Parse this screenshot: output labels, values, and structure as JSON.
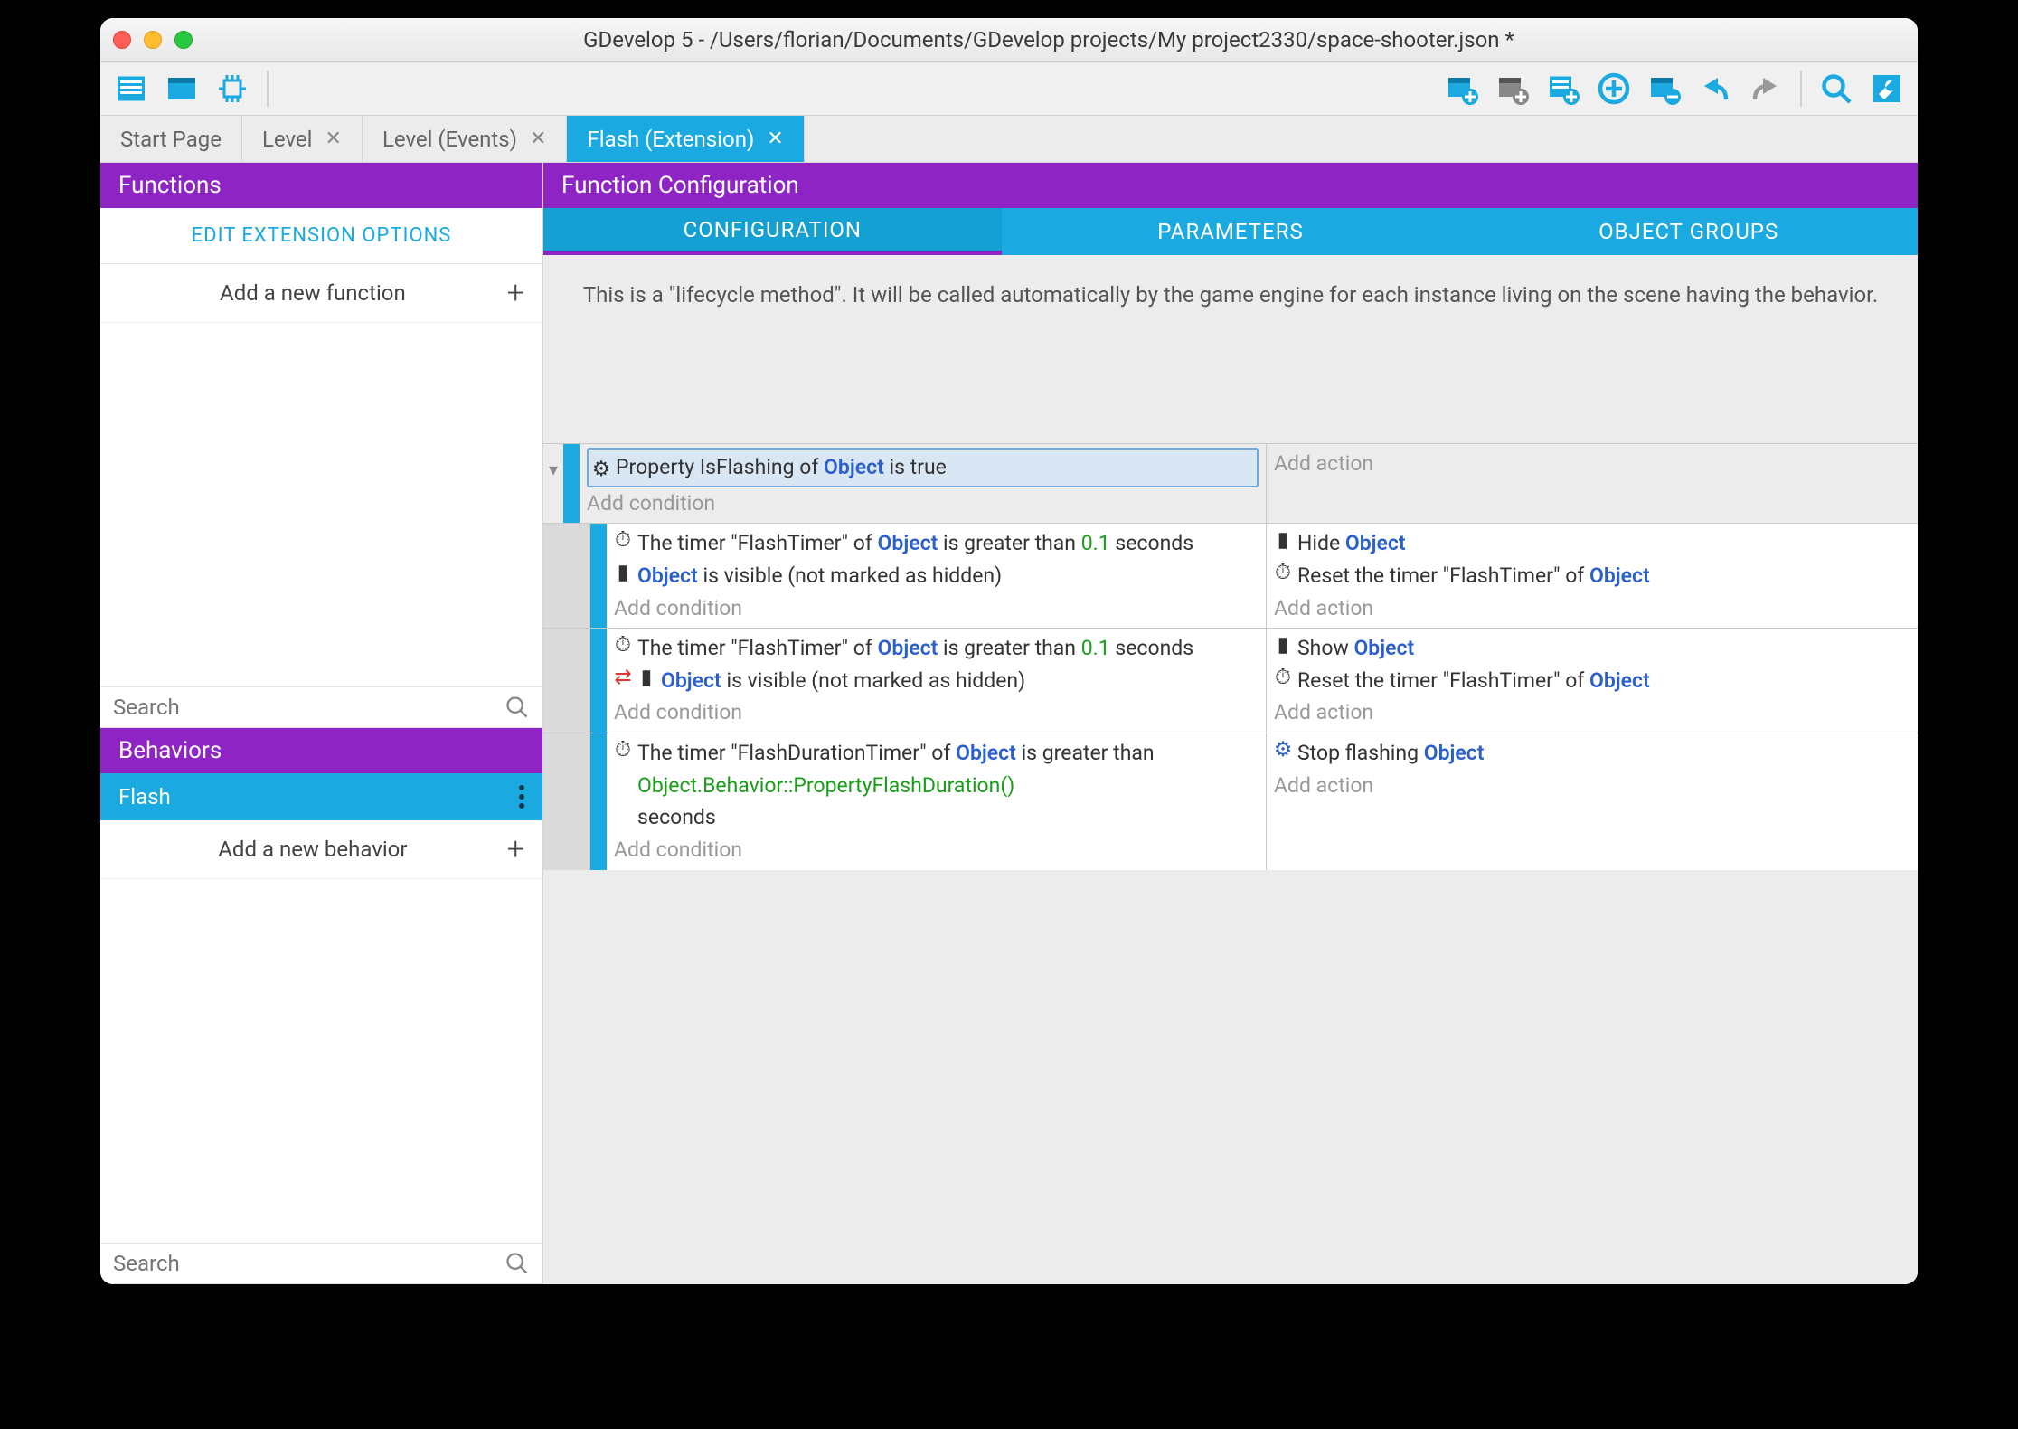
{
  "window": {
    "title": "GDevelop 5 - /Users/florian/Documents/GDevelop projects/My project2330/space-shooter.json *"
  },
  "tabs": [
    {
      "label": "Start Page",
      "closable": false
    },
    {
      "label": "Level",
      "closable": true
    },
    {
      "label": "Level (Events)",
      "closable": true
    },
    {
      "label": "Flash (Extension)",
      "closable": true,
      "active": true
    }
  ],
  "sidebar": {
    "functions_header": "Functions",
    "edit_ext_options": "EDIT EXTENSION OPTIONS",
    "add_function": "Add a new function",
    "search_placeholder": "Search",
    "behaviors_header": "Behaviors",
    "behavior_item": "Flash",
    "add_behavior": "Add a new behavior"
  },
  "config": {
    "header": "Function Configuration",
    "tabs": {
      "configuration": "CONFIGURATION",
      "parameters": "PARAMETERS",
      "object_groups": "OBJECT GROUPS"
    },
    "lifecycle_text": "This is a \"lifecycle method\". It will be called automatically by the game engine for each instance living on the scene having the behavior."
  },
  "events": {
    "add_condition": "Add condition",
    "add_action": "Add action",
    "obj": "Object",
    "root": {
      "cond_prefix": "Property IsFlashing of ",
      "cond_suffix": " is true"
    },
    "e1": {
      "c1a": "The timer \"FlashTimer\" of ",
      "c1b": " is greater than ",
      "c1_num": "0.1",
      "c1c": " seconds",
      "c2b": " is visible (not marked as hidden)",
      "a1": "Hide ",
      "a2a": "Reset the timer \"FlashTimer\" of "
    },
    "e2": {
      "c1a": "The timer \"FlashTimer\" of ",
      "c1b": " is greater than ",
      "c1_num": "0.1",
      "c1c": " seconds",
      "c2b": " is visible (not marked as hidden)",
      "a1": "Show ",
      "a2a": "Reset the timer \"FlashTimer\" of "
    },
    "e3": {
      "c1a": "The timer \"FlashDurationTimer\" of ",
      "c1b": " is greater than ",
      "c1_expr": "Object.Behavior::PropertyFlashDuration()",
      "c1c": " seconds",
      "a1": "Stop flashing "
    }
  }
}
